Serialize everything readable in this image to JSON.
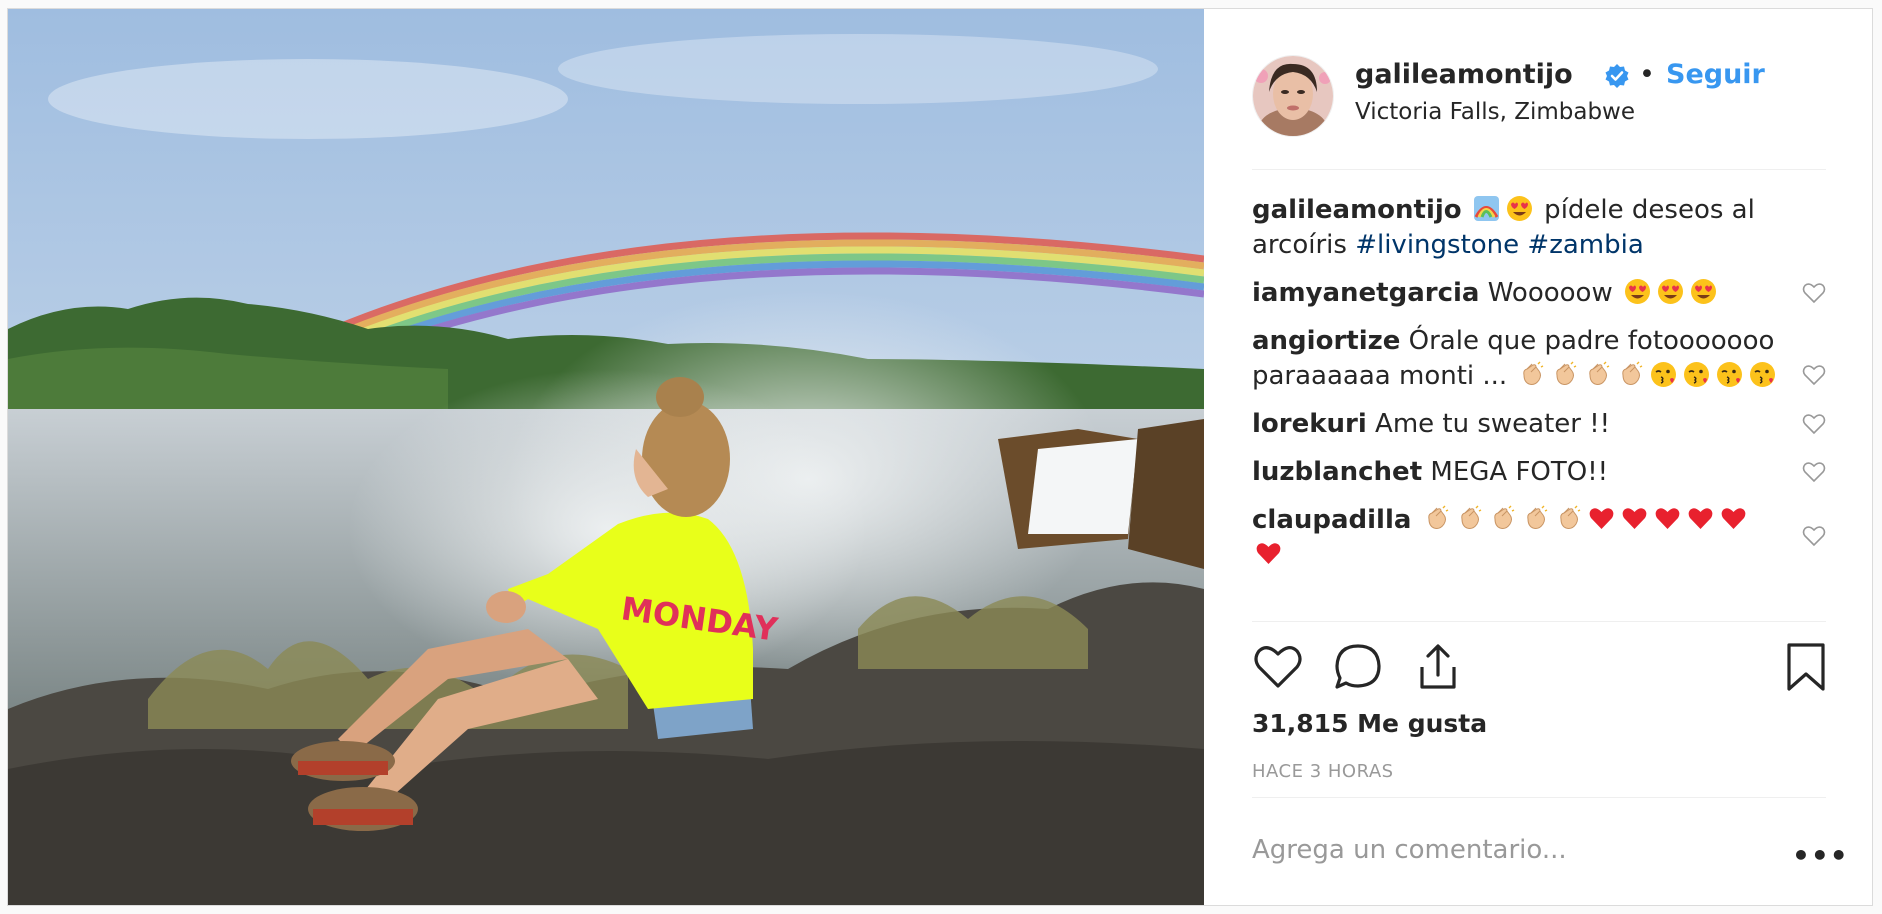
{
  "post": {
    "username": "galileamontijo",
    "follow_label": "Seguir",
    "separator": "•",
    "location": "Victoria Falls, Zimbabwe",
    "verified": true
  },
  "photo": {
    "sweater_text": "MONDAY",
    "subject": "rainbow over waterfall"
  },
  "caption": {
    "username": "galileamontijo",
    "emojis": [
      "rainbow",
      "heart-eyes"
    ],
    "text": " pídele deseos al arcoíris ",
    "hashtags": [
      "#livingstone",
      "#zambia"
    ]
  },
  "comments": [
    {
      "username": "iamyanetgarcia",
      "text": "Wooooow",
      "emojis_after": [
        "heart-eyes",
        "heart-eyes",
        "heart-eyes"
      ]
    },
    {
      "username": "angiortize",
      "text": "Órale que padre fotooooooo paraaaaaa monti ...",
      "emojis_after": [
        "clap",
        "clap",
        "clap",
        "clap",
        "kiss",
        "kiss",
        "kiss",
        "kiss"
      ]
    },
    {
      "username": "lorekuri",
      "text": "Ame tu sweater !!",
      "emojis_after": []
    },
    {
      "username": "luzblanchet",
      "text": "MEGA FOTO!!",
      "emojis_after": []
    },
    {
      "username": "claupadilla",
      "text": "",
      "emojis_after": [
        "clap",
        "clap",
        "clap",
        "clap",
        "clap",
        "red-heart",
        "red-heart",
        "red-heart",
        "red-heart",
        "red-heart",
        "red-heart"
      ]
    }
  ],
  "likes_text": "31,815 Me gusta",
  "timestamp": "HACE 3 HORAS",
  "comment_placeholder": "Agrega un comentario...",
  "more_label": "•••",
  "colors": {
    "accent": "#3897f0",
    "hashtag": "#003569",
    "text": "#262626",
    "muted": "#999999"
  }
}
